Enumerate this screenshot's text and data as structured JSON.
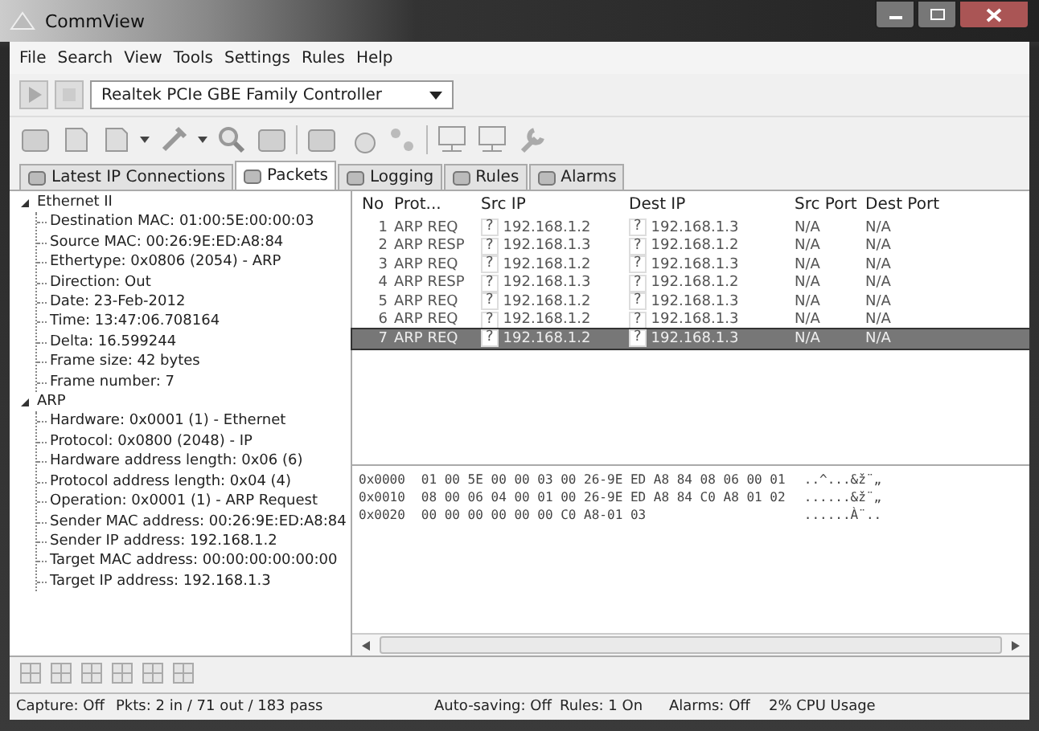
{
  "window": {
    "title": "CommView"
  },
  "menu": [
    "File",
    "Search",
    "View",
    "Tools",
    "Settings",
    "Rules",
    "Help"
  ],
  "adapter": {
    "value": "Realtek PCIe GBE Family Controller"
  },
  "tabs": [
    {
      "label": "Latest IP Connections",
      "selected": false
    },
    {
      "label": "Packets",
      "selected": true
    },
    {
      "label": "Logging",
      "selected": false
    },
    {
      "label": "Rules",
      "selected": false
    },
    {
      "label": "Alarms",
      "selected": false
    }
  ],
  "tree": [
    {
      "label": "Ethernet II",
      "expanded": true,
      "children": [
        {
          "label": "Destination MAC: 01:00:5E:00:00:03"
        },
        {
          "label": "Source MAC: 00:26:9E:ED:A8:84"
        },
        {
          "label": "Ethertype: 0x0806 (2054) - ARP"
        },
        {
          "label": "Direction: Out"
        },
        {
          "label": "Date: 23-Feb-2012"
        },
        {
          "label": "Time: 13:47:06.708164"
        },
        {
          "label": "Delta: 16.599244"
        },
        {
          "label": "Frame size: 42 bytes"
        },
        {
          "label": "Frame number: 7"
        }
      ]
    },
    {
      "label": "ARP",
      "expanded": true,
      "children": [
        {
          "label": "Hardware: 0x0001 (1) - Ethernet"
        },
        {
          "label": "Protocol: 0x0800 (2048) - IP"
        },
        {
          "label": "Hardware address length: 0x06 (6)"
        },
        {
          "label": "Protocol address length: 0x04 (4)"
        },
        {
          "label": "Operation: 0x0001 (1) - ARP Request"
        },
        {
          "label": "Sender MAC address: 00:26:9E:ED:A8:84"
        },
        {
          "label": "Sender IP address: 192.168.1.2"
        },
        {
          "label": "Target MAC address: 00:00:00:00:00:00"
        },
        {
          "label": "Target IP address: 192.168.1.3"
        }
      ]
    }
  ],
  "packets": {
    "columns": [
      "No",
      "Prot...",
      "Src IP",
      "Dest IP",
      "Src Port",
      "Dest Port"
    ],
    "rows": [
      {
        "no": "1",
        "proto": "ARP REQ",
        "src_flag": "?",
        "src_ip": "192.168.1.2",
        "dest_flag": "?",
        "dest_ip": "192.168.1.3",
        "src_port": "N/A",
        "dest_port": "N/A",
        "selected": false
      },
      {
        "no": "2",
        "proto": "ARP RESP",
        "src_flag": "?",
        "src_ip": "192.168.1.3",
        "dest_flag": "?",
        "dest_ip": "192.168.1.2",
        "src_port": "N/A",
        "dest_port": "N/A",
        "selected": false
      },
      {
        "no": "3",
        "proto": "ARP REQ",
        "src_flag": "?",
        "src_ip": "192.168.1.2",
        "dest_flag": "?",
        "dest_ip": "192.168.1.3",
        "src_port": "N/A",
        "dest_port": "N/A",
        "selected": false
      },
      {
        "no": "4",
        "proto": "ARP RESP",
        "src_flag": "?",
        "src_ip": "192.168.1.3",
        "dest_flag": "?",
        "dest_ip": "192.168.1.2",
        "src_port": "N/A",
        "dest_port": "N/A",
        "selected": false
      },
      {
        "no": "5",
        "proto": "ARP REQ",
        "src_flag": "?",
        "src_ip": "192.168.1.2",
        "dest_flag": "?",
        "dest_ip": "192.168.1.3",
        "src_port": "N/A",
        "dest_port": "N/A",
        "selected": false
      },
      {
        "no": "6",
        "proto": "ARP REQ",
        "src_flag": "?",
        "src_ip": "192.168.1.2",
        "dest_flag": "?",
        "dest_ip": "192.168.1.3",
        "src_port": "N/A",
        "dest_port": "N/A",
        "selected": false
      },
      {
        "no": "7",
        "proto": "ARP REQ",
        "src_flag": "?",
        "src_ip": "192.168.1.2",
        "dest_flag": "?",
        "dest_ip": "192.168.1.3",
        "src_port": "N/A",
        "dest_port": "N/A",
        "selected": true
      }
    ]
  },
  "hex_dump": [
    {
      "offset": "0x0000",
      "bytes": "01 00 5E 00 00 03 00 26-9E ED A8 84 08 06 00 01",
      "ascii": "..^...&ž¨„"
    },
    {
      "offset": "0x0010",
      "bytes": "08 00 06 04 00 01 00 26-9E ED A8 84 C0 A8 01 02",
      "ascii": "......&ž¨„"
    },
    {
      "offset": "0x0020",
      "bytes": "00 00 00 00 00 00 C0 A8-01 03",
      "ascii": "......À¨.."
    }
  ],
  "status_bar": [
    "Capture: Off",
    "Pkts: 2 in / 71 out / 183 pass",
    "Auto-saving: Off",
    "Rules: 1 On",
    "Alarms: Off",
    "2% CPU Usage"
  ]
}
